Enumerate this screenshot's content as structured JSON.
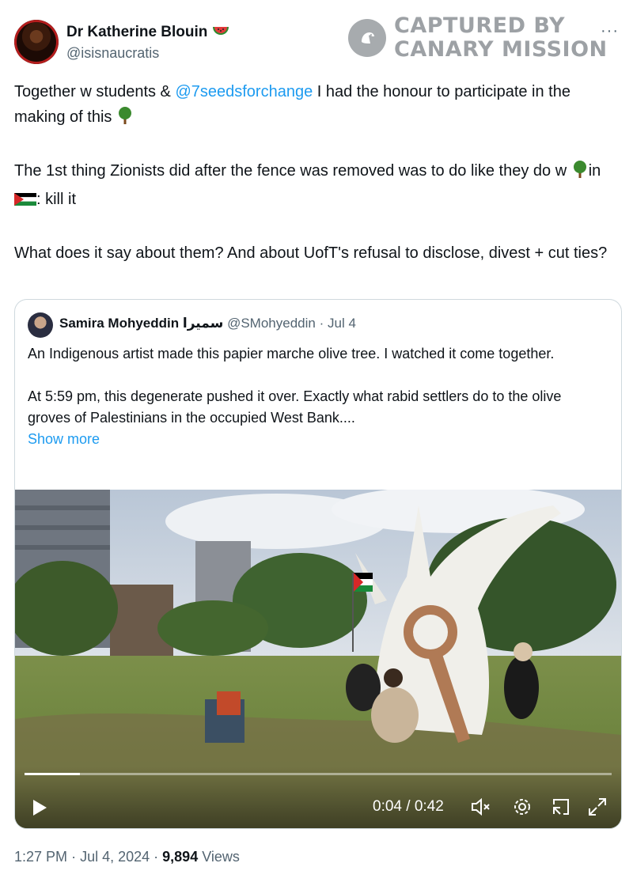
{
  "author": {
    "name": "Dr Katherine Blouin",
    "handle": "@isisnaucratis"
  },
  "watermark": {
    "line1": "CAPTURED BY",
    "line2": "CANARY MISSION"
  },
  "more_label": "···",
  "tweet": {
    "p1_before": "Together w students & ",
    "p1_mention": "@7seedsforchange",
    "p1_after": " I had the honour to participate in the making of this ",
    "p2_a": "The 1st thing Zionists did after the fence was removed was to do like they do w ",
    "p2_b": "in ",
    "p2_c": ": kill it",
    "p3": "What does it say about them? And about UofT's refusal to disclose, divest + cut ties?"
  },
  "quote": {
    "name": "Samira Mohyeddin سميرا",
    "handle": "@SMohyeddin",
    "date": "Jul 4",
    "p1": "An Indigenous artist made this papier marche olive tree. I watched it come together.",
    "p2": "At 5:59 pm, this degenerate pushed it over. Exactly what rabid settlers do to the olive groves of Palestinians in the occupied West Bank....",
    "show_more": "Show more",
    "video": {
      "time": "0:04 / 0:42",
      "progress": 0.095
    }
  },
  "footer": {
    "time": "1:27 PM",
    "date": "Jul 4, 2024",
    "views_count": "9,894",
    "views_label": "Views"
  },
  "colors": {
    "link": "#1d9bf0",
    "secondary_text": "#536471"
  }
}
